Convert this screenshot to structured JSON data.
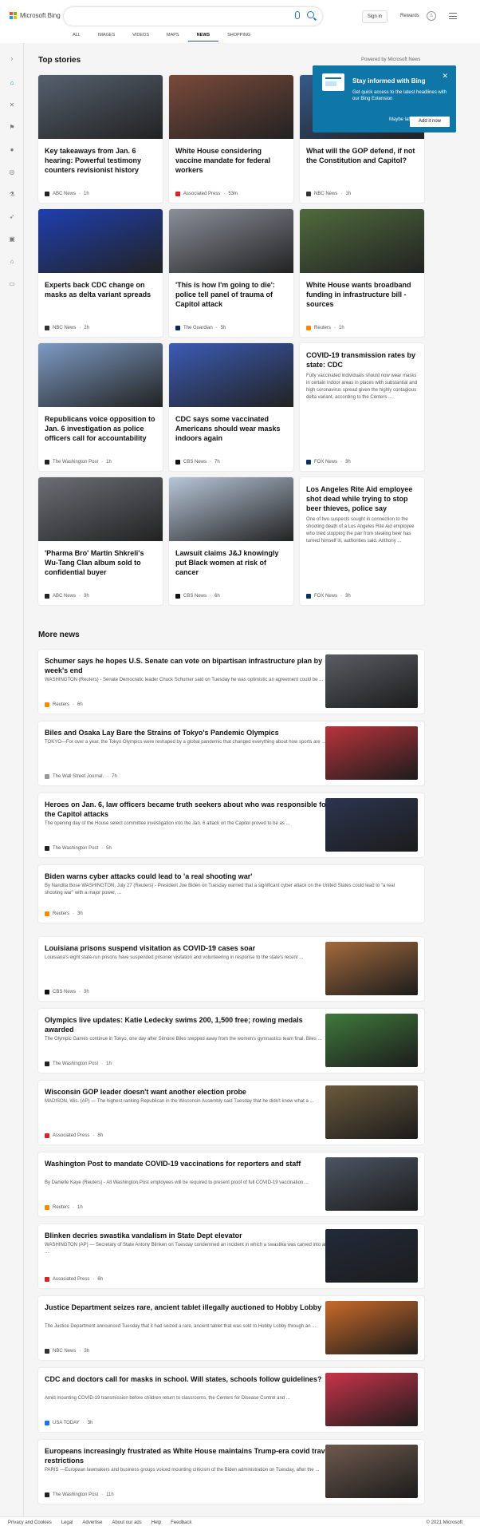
{
  "header": {
    "logo_text": "Microsoft Bing",
    "logo_colors": [
      "#f25022",
      "#7fba00",
      "#00a4ef",
      "#ffb900"
    ],
    "signin_label": "Sign in",
    "rewards_label": "Rewards",
    "tabs": [
      {
        "label": "ALL"
      },
      {
        "label": "IMAGES"
      },
      {
        "label": "VIDEOS"
      },
      {
        "label": "MAPS"
      },
      {
        "label": "NEWS"
      },
      {
        "label": "SHOPPING"
      }
    ]
  },
  "rail": {
    "icons": [
      "expand-icon",
      "home-icon",
      "sports-icon",
      "flag-icon",
      "location-icon",
      "world-icon",
      "science-icon",
      "tech-icon",
      "entertainment-icon",
      "politics-icon",
      "business-icon"
    ]
  },
  "top_stories": {
    "heading": "Top stories",
    "powered_by": "Powered by Microsoft News",
    "cards": [
      {
        "title": "Key takeaways from Jan. 6 hearing: Powerful testimony counters revisionist history",
        "source": "ABC News",
        "time": "1h",
        "img": "#55606e",
        "icon": "#222"
      },
      {
        "title": "White House considering vaccine mandate for federal workers",
        "source": "Associated Press",
        "time": "53m",
        "img": "#7a4a3a",
        "icon": "#d22"
      },
      {
        "title": "What will the GOP defend, if not the Constitution and Capitol?",
        "source": "NBC News",
        "time": "1h",
        "img": "#355a8a",
        "icon": "#333"
      },
      {
        "title": "Experts back CDC change on masks as delta variant spreads",
        "source": "NBC News",
        "time": "2h",
        "img": "#1e3fb0",
        "icon": "#333"
      },
      {
        "title": "'This is how I'm going to die': police tell panel of trauma of Capitol attack",
        "source": "The Guardian",
        "time": "5h",
        "img": "#8b8f9a",
        "icon": "#052962"
      },
      {
        "title": "White House wants broadband funding in infrastructure bill - sources",
        "source": "Reuters",
        "time": "1h",
        "img": "#4f6b3c",
        "icon": "#f80"
      },
      {
        "title": "Republicans voice opposition to Jan. 6 investigation as police officers call for accountability",
        "source": "The Washington Post",
        "time": "1h",
        "img": "#7d9bc4",
        "icon": "#222"
      },
      {
        "title": "CDC says some vaccinated Americans should wear masks indoors again",
        "source": "CBS News",
        "time": "7h",
        "img": "#3b5bb5",
        "icon": "#111"
      },
      {
        "title": "COVID-19 transmission rates by state: CDC",
        "snippet": "Fully vaccinated individuals should now wear masks in certain indoor areas in places with substantial and high coronavirus spread given the highly contagious delta variant, according to the Centers ...",
        "source": "FOX News",
        "time": "3h",
        "img": "",
        "icon": "#003366"
      },
      {
        "title": "'Pharma Bro' Martin Shkreli's Wu-Tang Clan album sold to confidential buyer",
        "source": "ABC News",
        "time": "3h",
        "img": "#6b6e75",
        "icon": "#222"
      },
      {
        "title": "Lawsuit claims J&J knowingly put Black women at risk of cancer",
        "source": "CBS News",
        "time": "6h",
        "img": "#b7c6d8",
        "icon": "#111"
      },
      {
        "title": "Los Angeles Rite Aid employee shot dead while trying to stop beer thieves, police say",
        "snippet": "One of two suspects sought in connection to the shooting death of a Los Angeles Rite Aid employee who tried stopping the pair from stealing beer has turned himself in, authorities said. Anthony ...",
        "source": "FOX News",
        "time": "3h",
        "img": "",
        "icon": "#003366"
      }
    ]
  },
  "popup": {
    "title": "Stay informed with Bing",
    "body": "Get quick access to the latest headlines with our Bing Extension",
    "later_label": "Maybe later",
    "add_label": "Add it now",
    "close_glyph": "✕"
  },
  "more_news": {
    "heading": "More news",
    "items": [
      {
        "title": "Schumer says he hopes U.S. Senate can vote on bipartisan infrastructure plan by week's end",
        "snippet": "WASHINGTON (Reuters) - Senate Democratic leader Chuck Schumer said on Tuesday he was optimistic an agreement could be ...",
        "source": "Reuters",
        "time": "6h",
        "img": "#5a5d63",
        "icon": "#f80"
      },
      {
        "title": "Biles and Osaka Lay Bare the Strains of Tokyo's Pandemic Olympics",
        "snippet": "TOKYO—For over a year, the Tokyo Olympics were reshaped by a global pandemic that changed everything about how sports are ...",
        "source": "The Wall Street Journal.",
        "time": "7h",
        "img": "#b8343b",
        "icon": "#999"
      },
      {
        "title": "Heroes on Jan. 6, law officers became truth seekers about who was responsible for the Capitol attacks",
        "snippet": "The opening day of the House select committee investigation into the Jan. 6 attack on the Capitol proved to be as ...",
        "source": "The Washington Post",
        "time": "5h",
        "img": "#2c3550",
        "icon": "#222"
      },
      {
        "title": "Biden warns cyber attacks could lead to 'a real shooting war'",
        "snippet": "By Nandita Bose WASHINGTON, July 27 (Reuters) - President Joe Biden on Tuesday warned that a significant cyber attack on the United States could lead to \"a real shooting war\" with a major power, ...",
        "source": "Reuters",
        "time": "3h",
        "img": "",
        "icon": "#f80"
      },
      {
        "title": "Louisiana prisons suspend visitation as COVID-19 cases soar",
        "snippet": "Louisiana's eight state-run prisons have suspended prisoner visitation and volunteering in response to the state's recent ...",
        "source": "CBS News",
        "time": "3h",
        "img": "#a36a3d",
        "icon": "#111"
      },
      {
        "title": "Olympics live updates: Katie Ledecky swims 200, 1,500 free; rowing medals awarded",
        "snippet": "The Olympic Games continue in Tokyo, one day after Simone Biles stepped away from the women's gymnastics team final. Biles ...",
        "source": "The Washington Post",
        "time": "1h",
        "img": "#3f7a3c",
        "icon": "#222"
      },
      {
        "title": "Wisconsin GOP leader doesn't want another election probe",
        "snippet": "MADISON, Wis. (AP) — The highest ranking Republican in the Wisconsin Assembly said Tuesday that he didn't know what a ...",
        "source": "Associated Press",
        "time": "8h",
        "img": "#6b5a3b",
        "icon": "#d22"
      },
      {
        "title": "Washington Post to mandate COVID-19 vaccinations for reporters and staff",
        "snippet": "By Danielle Kaye (Reuters) - All Washington Post employees will be required to present proof of full COVID-19 vaccination ...",
        "source": "Reuters",
        "time": "1h",
        "img": "#4c5563",
        "icon": "#f80"
      },
      {
        "title": "Blinken decries swastika vandalism in State Dept elevator",
        "snippet": "WASHINGTON (AP) — Secretary of State Antony Blinken on Tuesday condemned an incident in which a swastika was carved into an ...",
        "source": "Associated Press",
        "time": "6h",
        "img": "#222a3a",
        "icon": "#d22"
      },
      {
        "title": "Justice Department seizes rare, ancient tablet illegally auctioned to Hobby Lobby",
        "snippet": "The Justice Department announced Tuesday that it had seized a rare, ancient tablet that was sold to Hobby Lobby through an ...",
        "source": "NBC News",
        "time": "3h",
        "img": "#c86a2a",
        "icon": "#333"
      },
      {
        "title": "CDC and doctors call for masks in school. Will states, schools follow guidelines?",
        "snippet": "Amid mounting COVID-19 transmission before children return to classrooms, the Centers for Disease Control and ...",
        "source": "USA TODAY",
        "time": "3h",
        "img": "#c8344a",
        "icon": "#1a73e8"
      },
      {
        "title": "Europeans increasingly frustrated as White House maintains Trump-era covid travel restrictions",
        "snippet": "PARIS —European lawmakers and business groups voiced mounting criticism of the Biden administration on Tuesday, after the ...",
        "source": "The Washington Post",
        "time": "11h",
        "img": "#6e5a4e",
        "icon": "#222"
      }
    ]
  },
  "footer": {
    "links": [
      "Privacy and Cookies",
      "Legal",
      "Advertise",
      "About our ads",
      "Help",
      "Feedback"
    ],
    "copyright": "© 2021 Microsoft"
  }
}
